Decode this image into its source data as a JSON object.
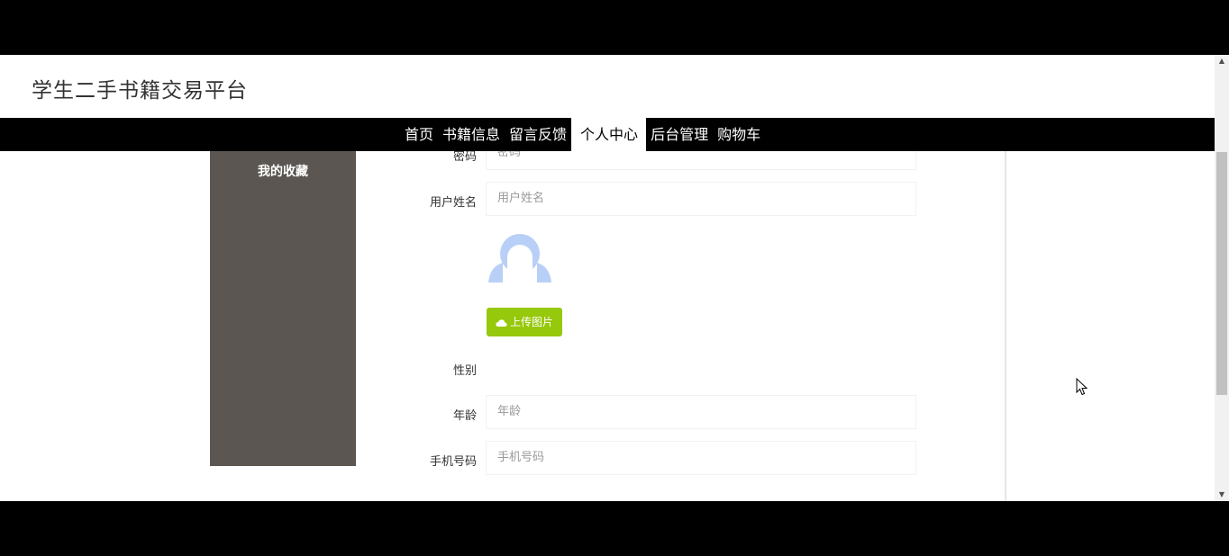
{
  "header": {
    "title": "学生二手书籍交易平台"
  },
  "nav": {
    "items": [
      {
        "label": "首页"
      },
      {
        "label": "书籍信息"
      },
      {
        "label": "留言反馈"
      },
      {
        "label": "个人中心"
      },
      {
        "label": "后台管理"
      },
      {
        "label": "购物车"
      }
    ],
    "active": "个人中心"
  },
  "sidebar": {
    "items": [
      {
        "label": "我的收藏"
      }
    ]
  },
  "form": {
    "password": {
      "label": "密码",
      "placeholder": "密码"
    },
    "username": {
      "label": "用户姓名",
      "placeholder": "用户姓名"
    },
    "upload_label": "上传图片",
    "gender": {
      "label": "性别"
    },
    "age": {
      "label": "年龄",
      "placeholder": "年龄"
    },
    "phone": {
      "label": "手机号码",
      "placeholder": "手机号码"
    }
  },
  "colors": {
    "nav_bg": "#000000",
    "sidebar_bg": "#5b5651",
    "upload_btn": "#96c80b",
    "avatar": "#b8cff7"
  }
}
